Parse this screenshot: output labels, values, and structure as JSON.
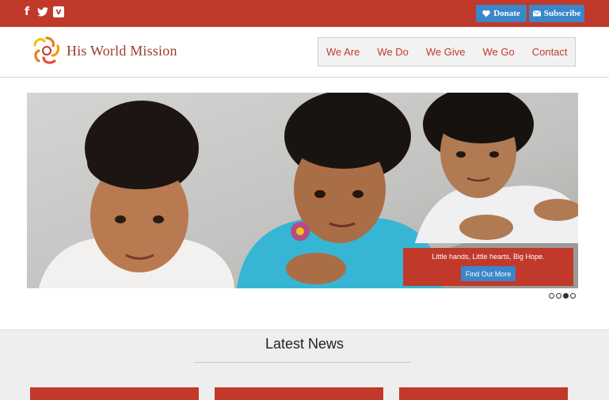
{
  "topbar": {
    "social": [
      {
        "icon": "facebook-icon",
        "glyph": "f"
      },
      {
        "icon": "twitter-icon",
        "glyph": "𝕥"
      },
      {
        "icon": "vimeo-icon",
        "glyph": "v"
      }
    ],
    "donate_label": "Donate",
    "subscribe_label": "Subscribe"
  },
  "header": {
    "logo_text": "His World Mission",
    "nav": [
      "We Are",
      "We Do",
      "We Give",
      "We Go",
      "Contact"
    ]
  },
  "hero": {
    "caption": "Little hands, Little hearts, Big Hope.",
    "button_label": "Find Out More",
    "slides_total": 4,
    "slide_active": 3
  },
  "news": {
    "title": "Latest News"
  },
  "colors": {
    "brand_red": "#c0392b",
    "button_blue": "#3a86c8"
  }
}
